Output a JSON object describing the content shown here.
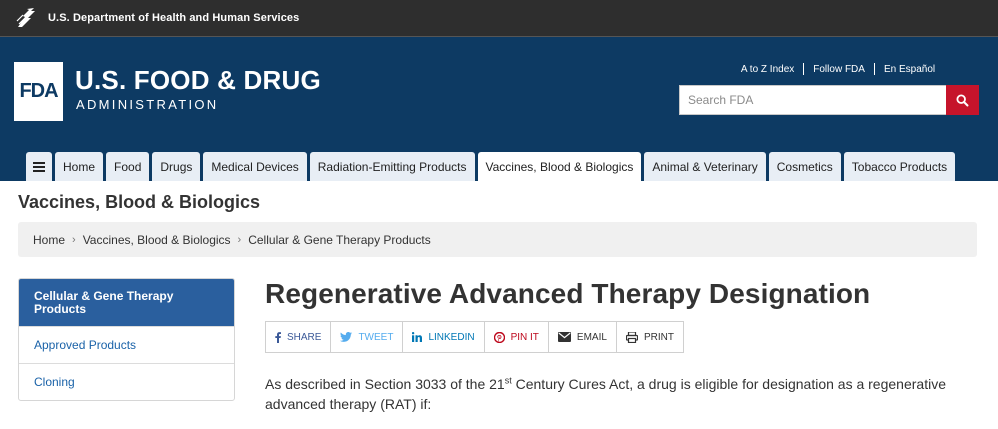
{
  "hhs": {
    "text": "U.S. Department of Health and Human Services"
  },
  "header": {
    "logo_text": "FDA",
    "title": "U.S. FOOD & DRUG",
    "subtitle": "ADMINISTRATION",
    "util_links": [
      "A to Z Index",
      "Follow FDA",
      "En Español"
    ],
    "search_placeholder": "Search FDA"
  },
  "nav": {
    "tabs": [
      "Home",
      "Food",
      "Drugs",
      "Medical Devices",
      "Radiation-Emitting Products",
      "Vaccines, Blood & Biologics",
      "Animal & Veterinary",
      "Cosmetics",
      "Tobacco Products"
    ]
  },
  "section_title": "Vaccines, Blood & Biologics",
  "breadcrumb": [
    "Home",
    "Vaccines, Blood & Biologics",
    "Cellular & Gene Therapy Products"
  ],
  "sidebar": {
    "items": [
      "Cellular & Gene Therapy Products",
      "Approved Products",
      "Cloning"
    ]
  },
  "page_title": "Regenerative Advanced Therapy Designation",
  "share": {
    "facebook": "SHARE",
    "twitter": "TWEET",
    "linkedin": "LINKEDIN",
    "pinterest": "PIN IT",
    "email": "EMAIL",
    "print": "PRINT"
  },
  "intro": {
    "part1": "As described in Section 3033 of the 21",
    "sup": "st",
    "part2": " Century Cures Act, a drug is eligible for designation as a regenerative advanced therapy (RAT) if:"
  },
  "colors": {
    "header_bg": "#0d3a63",
    "hhs_bg": "#2e2e2e",
    "search_button": "#c6142b",
    "sidebar_active": "#2a5f9e",
    "link": "#1a62a8"
  }
}
